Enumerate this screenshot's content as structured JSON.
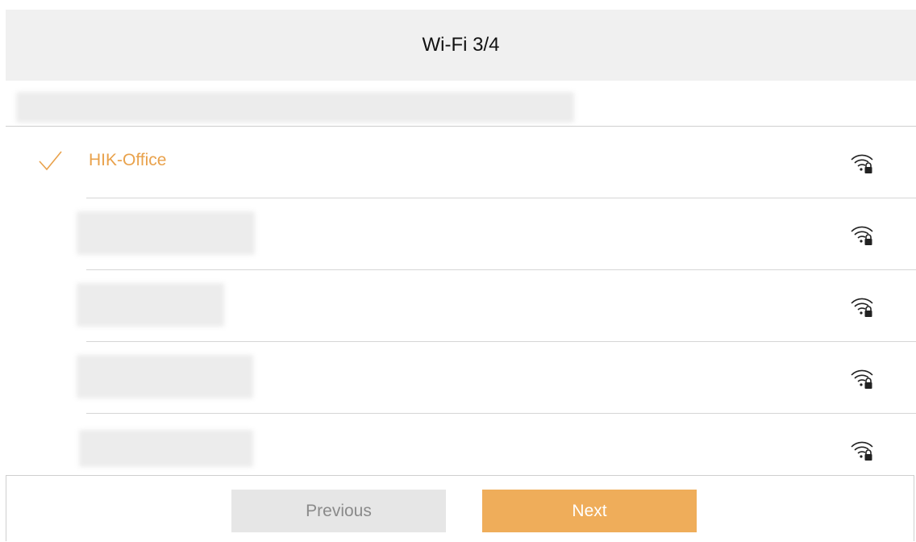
{
  "header": {
    "title": "Wi-Fi 3/4"
  },
  "networks": [
    {
      "ssid": "HIK-Office",
      "selected": true,
      "secured": true,
      "ssid_visible": true
    },
    {
      "ssid": "",
      "selected": false,
      "secured": true,
      "ssid_visible": false
    },
    {
      "ssid": "",
      "selected": false,
      "secured": true,
      "ssid_visible": false
    },
    {
      "ssid": "",
      "selected": false,
      "secured": true,
      "ssid_visible": false
    },
    {
      "ssid": "",
      "selected": false,
      "secured": true,
      "ssid_visible": false
    }
  ],
  "footer": {
    "previous_label": "Previous",
    "next_label": "Next"
  },
  "icons": {
    "selected": "check-icon",
    "network": "wifi-lock-icon"
  },
  "colors": {
    "accent": "#efad5a",
    "selected_text": "#e9a24c",
    "header_bg": "#f0f0f0",
    "secondary_button_bg": "#e6e6e6"
  }
}
